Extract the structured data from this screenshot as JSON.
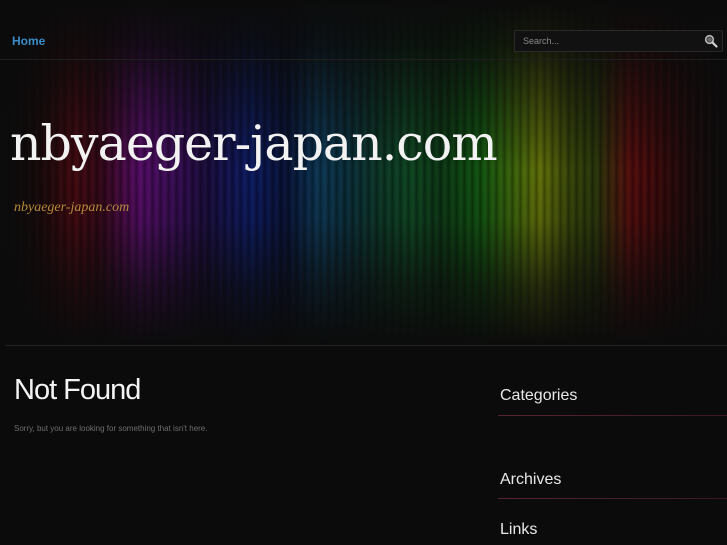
{
  "nav": {
    "home_label": "Home",
    "search_placeholder": "Search...",
    "search_icon": "magnifier-icon"
  },
  "header": {
    "site_title": "nbyaeger-japan.com",
    "tagline": "nbyaeger-japan.com"
  },
  "content": {
    "title": "Not Found",
    "message": "Sorry, but you are looking for something that isn't here."
  },
  "sidebar": {
    "widgets": [
      {
        "title": "Categories"
      },
      {
        "title": "Archives"
      },
      {
        "title": "Links"
      }
    ]
  },
  "colors": {
    "accent": "#3a8cc8",
    "tagline": "#b58a3a",
    "background": "#0b0b0b",
    "widget_rule": "#5a2430"
  }
}
